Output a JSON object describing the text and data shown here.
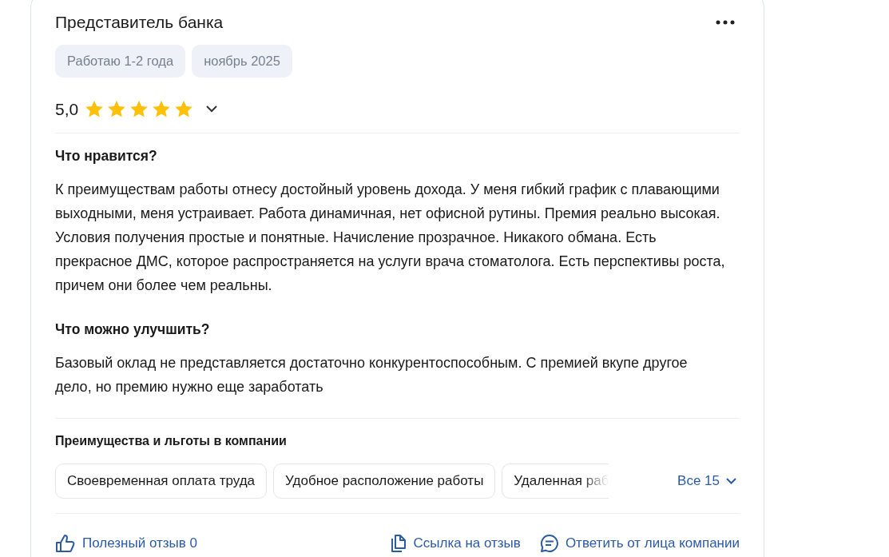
{
  "review": {
    "title": "Представитель банка",
    "tags": [
      "Работаю 1-2 года",
      "ноябрь 2025"
    ],
    "rating": {
      "value": "5,0",
      "stars": 5,
      "expanded": false
    },
    "sections": [
      {
        "heading": "Что нравится?",
        "text": "К преимуществам работы отнесу достойный уровень дохода. У меня гибкий график с плавающими выходными, меня устраивает. Работа динамичная, нет офисной рутины. Премия реально высокая. Условия получения простые и понятные. Начисление прозрачное. Никакого обмана. Есть прекрасное ДМС, которое распространяется на услуги врача стоматолога. Есть перспективы роста, причем они более чем реальны."
      },
      {
        "heading": "Что можно улучшить?",
        "text": "Базовый оклад не представляется достаточно конкурентоспособным. С премией вкупе другое дело, но премию нужно еще заработать"
      }
    ],
    "benefits": {
      "heading": "Преимущества и льготы в компании",
      "items": [
        "Своевременная оплата труда",
        "Удобное расположение работы",
        "Удаленная раб"
      ],
      "show_all": "Все 15"
    },
    "actions": [
      {
        "kind": "like",
        "label": "Полезный отзыв 0"
      },
      {
        "kind": "link",
        "label": "Ссылка на отзыв"
      },
      {
        "kind": "reply",
        "label": "Ответить от лица компании"
      }
    ]
  }
}
